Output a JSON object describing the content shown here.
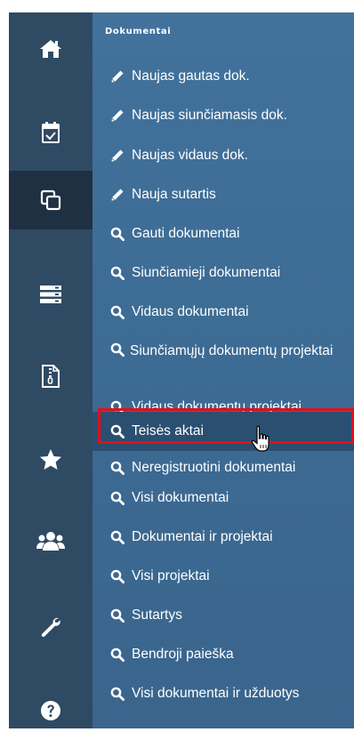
{
  "rail": {
    "items": [
      {
        "icon": "home-icon",
        "active": false
      },
      {
        "icon": "calendar-check-icon",
        "active": false
      },
      {
        "icon": "copy-documents-icon",
        "active": true
      },
      {
        "icon": "server-list-icon",
        "active": false
      },
      {
        "icon": "file-archive-icon",
        "active": false
      },
      {
        "icon": "star-icon",
        "active": false
      },
      {
        "icon": "users-icon",
        "active": false
      },
      {
        "icon": "wrench-icon",
        "active": false
      },
      {
        "icon": "help-icon",
        "active": false
      }
    ]
  },
  "panel": {
    "section_title": "Dokumentai",
    "items": [
      {
        "label": "Naujas gautas dok.",
        "icon": "pencil-icon"
      },
      {
        "label": "Naujas siunčiamasis dok.",
        "icon": "pencil-icon"
      },
      {
        "label": "Naujas vidaus dok.",
        "icon": "pencil-icon"
      },
      {
        "label": "Nauja sutartis",
        "icon": "pencil-icon"
      },
      {
        "label": "Gauti dokumentai",
        "icon": "search-icon"
      },
      {
        "label": "Siunčiamieji dokumentai",
        "icon": "search-icon"
      },
      {
        "label": "Vidaus dokumentai",
        "icon": "search-icon"
      },
      {
        "label": "Siunčiamųjų dokumentų projektai",
        "icon": "search-icon"
      },
      {
        "label": "Vidaus dokumentų projektai",
        "icon": "search-icon"
      },
      {
        "label": "Teisės aktai",
        "icon": "search-icon",
        "highlighted": true
      },
      {
        "label": "Neregistruotini dokumentai",
        "icon": "search-icon"
      },
      {
        "label": "Visi dokumentai",
        "icon": "search-icon"
      },
      {
        "label": "Dokumentai ir projektai",
        "icon": "search-icon"
      },
      {
        "label": "Visi projektai",
        "icon": "search-icon"
      },
      {
        "label": "Sutartys",
        "icon": "search-icon"
      },
      {
        "label": "Bendroji paieška",
        "icon": "search-icon"
      },
      {
        "label": "Visi dokumentai ir užduotys",
        "icon": "search-icon"
      }
    ]
  },
  "colors": {
    "rail": "#2f4a63",
    "rail_active": "#1f3042",
    "panel": "#3d6c95",
    "highlight_border": "#e0101a"
  }
}
